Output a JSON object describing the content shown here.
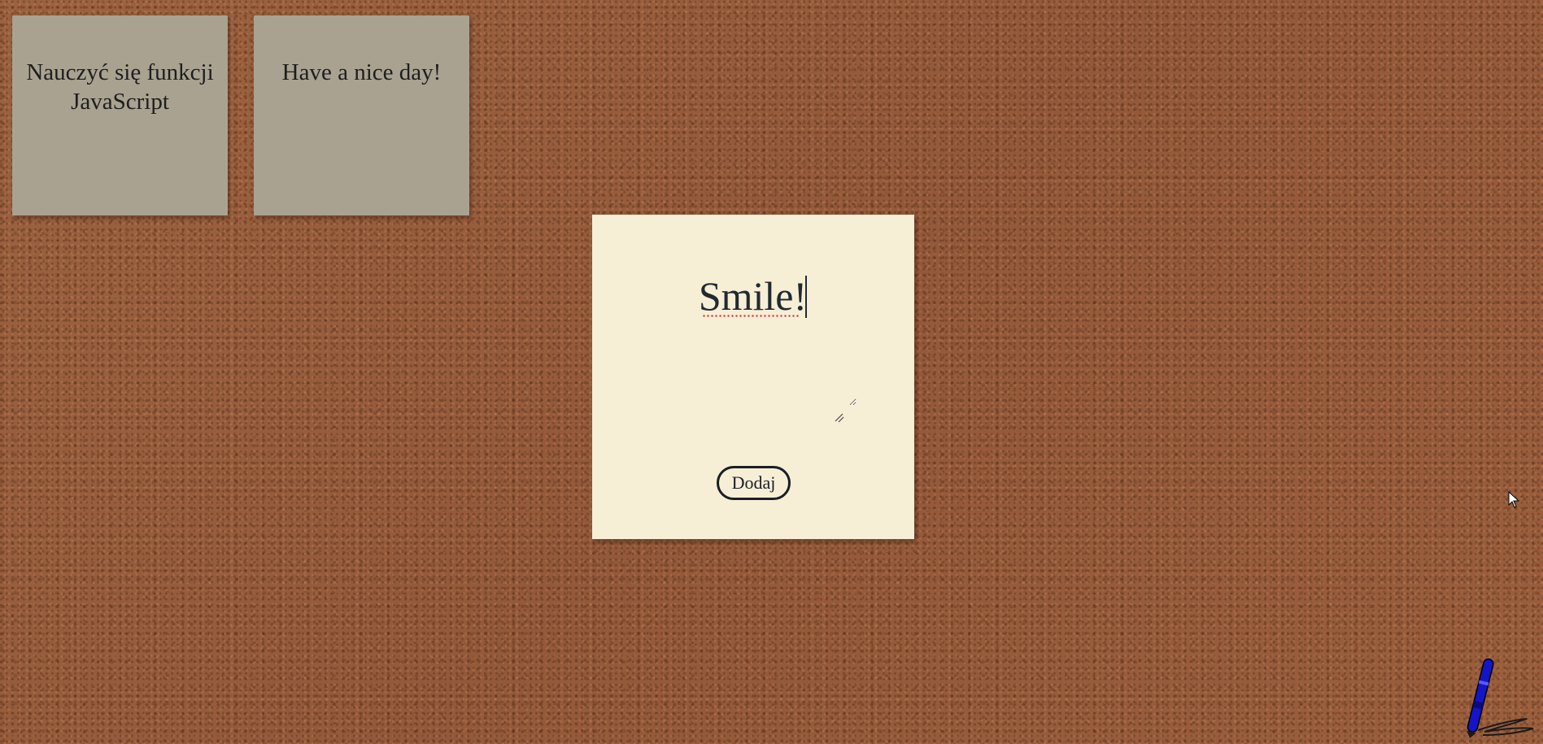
{
  "notes": [
    {
      "text": "Nauczyć się funkcji JavaScript"
    },
    {
      "text": "Have a nice day!"
    }
  ],
  "editor": {
    "value": "Smile!",
    "add_button": "Dodaj"
  },
  "icons": {
    "pen": "pen-icon",
    "cursor": "mouse-cursor-icon",
    "resize": "resize-grip-icon"
  },
  "colors": {
    "board": "#9a5f3a",
    "saved_note": "#a9a291",
    "editor_note": "#f7eed6",
    "pen_blue": "#1414c8"
  }
}
